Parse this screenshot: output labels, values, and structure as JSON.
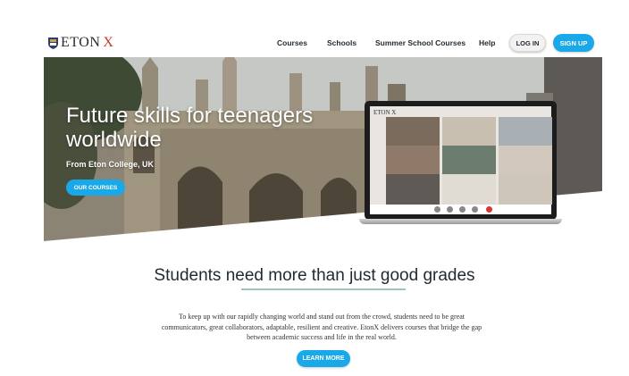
{
  "header": {
    "logo_text": "ETON",
    "logo_mark": "X",
    "nav": [
      "Courses",
      "Schools",
      "Summer School Courses",
      "Help"
    ],
    "login_label": "LOG IN",
    "signup_label": "SIGN UP"
  },
  "hero": {
    "title": "Future skills for teenagers worldwide",
    "subtitle": "From Eton College, UK",
    "cta_label": "OUR COURSES",
    "laptop_logo": "ETON X"
  },
  "section": {
    "title": "Students need more than just good grades",
    "body": "To keep up with our rapidly changing world and stand out from the crowd, students need to be great communicators, great collaborators, adaptable, resilient and creative. EtonX delivers courses that bridge the gap between academic success and life in the real world.",
    "cta_label": "LEARN MORE"
  },
  "colors": {
    "accent": "#1aa9e8",
    "logo_x": "#c23a2c",
    "divider": "#9cc7b6"
  }
}
